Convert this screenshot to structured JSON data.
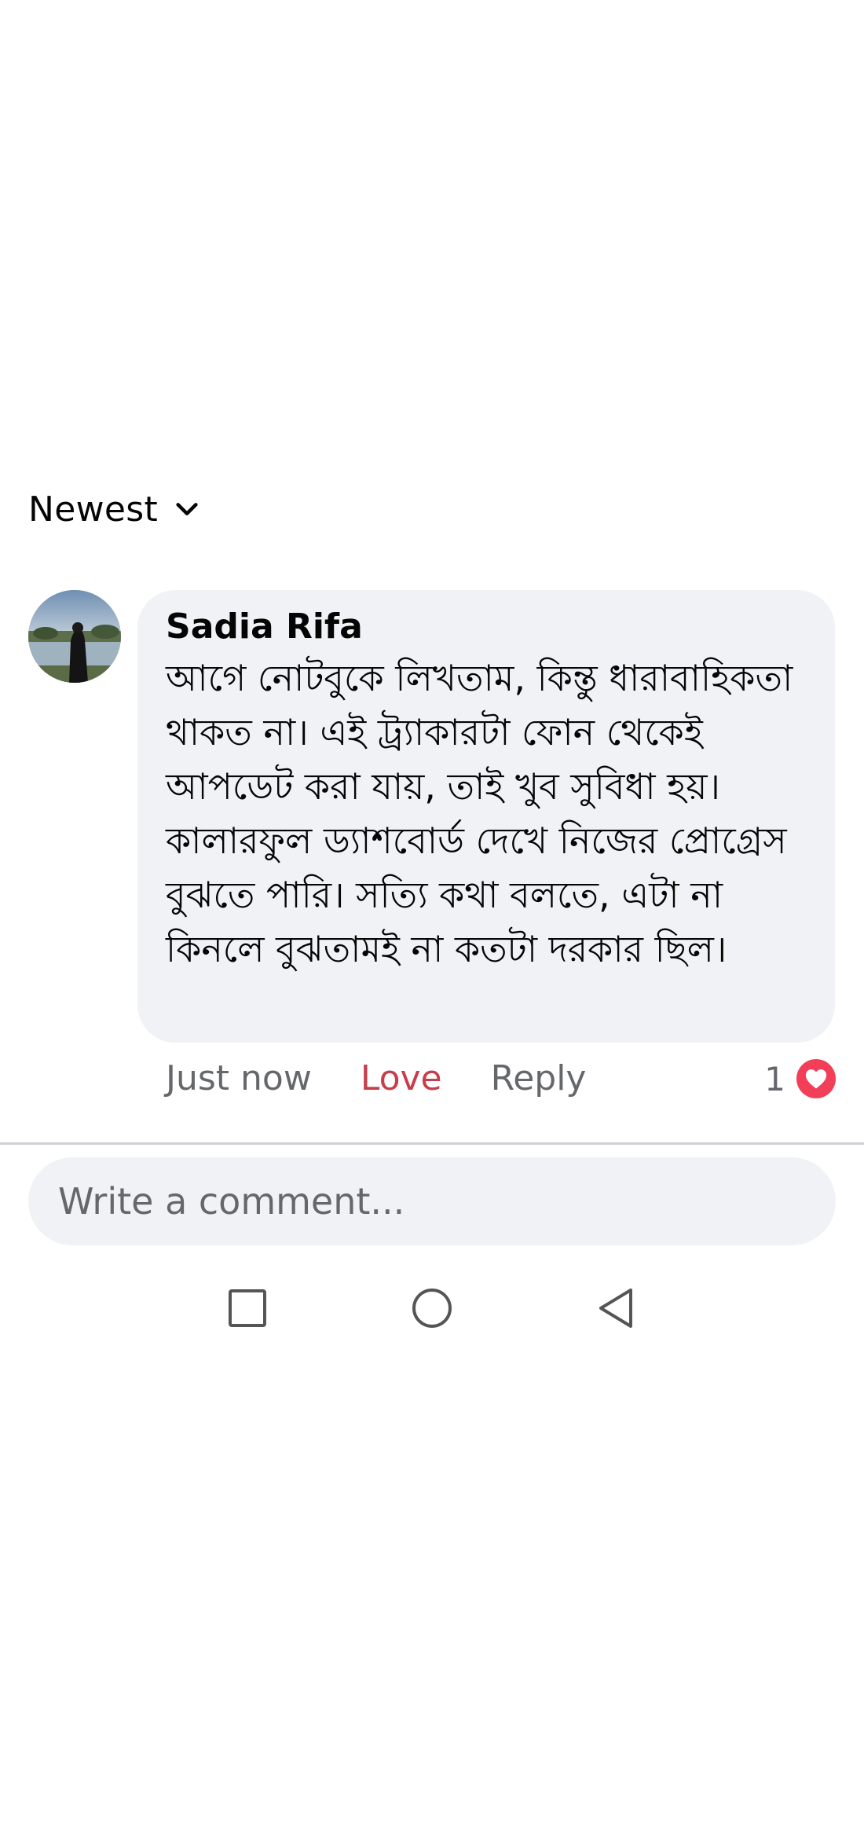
{
  "sort": {
    "label": "Newest",
    "icon": "chevron-down-icon"
  },
  "comment": {
    "author": "Sadia Rifa",
    "text": "আগে নোটবুকে লিখতাম, কিন্তু ধারাবাহিকতা থাকত না। এই ট্র্যাকারটা ফোন থেকেই আপডেট করা যায়, তাই খুব সুবিধা হয়। কালারফুল ড্যাশবোর্ড দেখে নিজের প্রোগ্রেস বুঝতে পারি। সত্যি কথা বলতে, এটা না কিনলে বুঝতামই না কতটা দরকার ছিল।",
    "time": "Just now",
    "love_label": "Love",
    "reply_label": "Reply",
    "reaction_count": "1",
    "reaction_icon": "heart-icon"
  },
  "composer": {
    "placeholder": "Write a comment..."
  },
  "navigation": {
    "items": [
      "recents-square-icon",
      "home-circle-icon",
      "back-triangle-icon"
    ]
  },
  "colors": {
    "love": "#c93d4b",
    "bubble": "#f0f2f5",
    "heart": "#f33e58",
    "muted": "#65676b"
  }
}
